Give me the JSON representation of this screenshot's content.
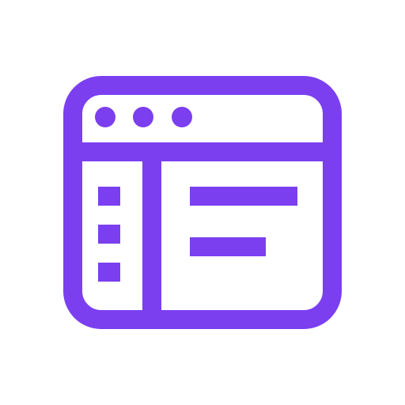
{
  "icon": {
    "name": "browser-window-icon",
    "description_name": "app-window-sidebar-layout",
    "accent_color": "#7B3FF0",
    "background_color": "#FFFFFF",
    "window_dots": 3,
    "sidebar_items": 3,
    "content_lines": 2
  }
}
